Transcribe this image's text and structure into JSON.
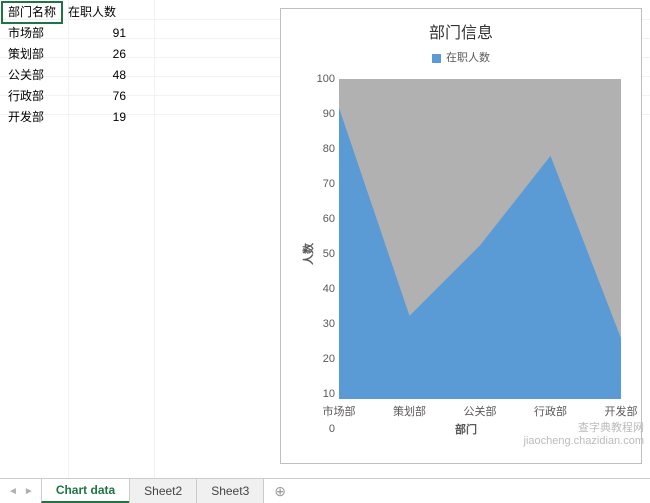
{
  "table": {
    "headers": [
      "部门名称",
      "在职人数"
    ],
    "rows": [
      {
        "dept": "市场部",
        "count": 91
      },
      {
        "dept": "策划部",
        "count": 26
      },
      {
        "dept": "公关部",
        "count": 48
      },
      {
        "dept": "行政部",
        "count": 76
      },
      {
        "dept": "开发部",
        "count": 19
      }
    ]
  },
  "chart_data": {
    "type": "area",
    "title": "部门信息",
    "legend": "在职人数",
    "xlabel": "部门",
    "ylabel": "人数",
    "ylim": [
      0,
      100
    ],
    "yticks": [
      0,
      10,
      20,
      30,
      40,
      50,
      60,
      70,
      80,
      90,
      100
    ],
    "categories": [
      "市场部",
      "策划部",
      "公关部",
      "行政部",
      "开发部"
    ],
    "values": [
      91,
      26,
      48,
      76,
      19
    ],
    "series_color": "#5b9bd5",
    "plot_bg": "#b1b1b1"
  },
  "tabs": {
    "items": [
      "Chart data",
      "Sheet2",
      "Sheet3"
    ],
    "active": 0,
    "newtab_glyph": "⊕"
  },
  "nav_glyphs": {
    "first": "◄",
    "last": "►"
  },
  "watermark": {
    "line1": "查字典教程网",
    "line2": "jiaocheng.chazidian.com"
  }
}
